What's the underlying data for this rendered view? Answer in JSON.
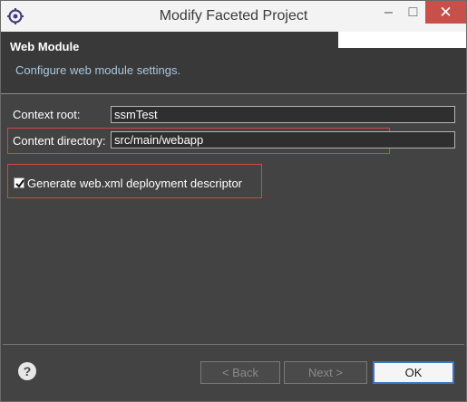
{
  "window": {
    "title": "Modify Faceted Project"
  },
  "titlebar": {
    "minimize": "–",
    "maximize": "□",
    "close": "✕"
  },
  "header": {
    "title": "Web Module",
    "description": "Configure web module settings."
  },
  "form": {
    "context_root_label": "Context root:",
    "context_root_value": "ssmTest",
    "content_dir_label": "Content directory:",
    "content_dir_value": "src/main/webapp",
    "generate_label": "Generate web.xml deployment descriptor",
    "generate_checked": true
  },
  "buttons": {
    "back": "< Back",
    "next": "Next >",
    "ok": "OK",
    "help": "?"
  },
  "colors": {
    "highlight": "#d54545",
    "default_button_border": "#3a78c4",
    "close_button": "#c7504a"
  }
}
